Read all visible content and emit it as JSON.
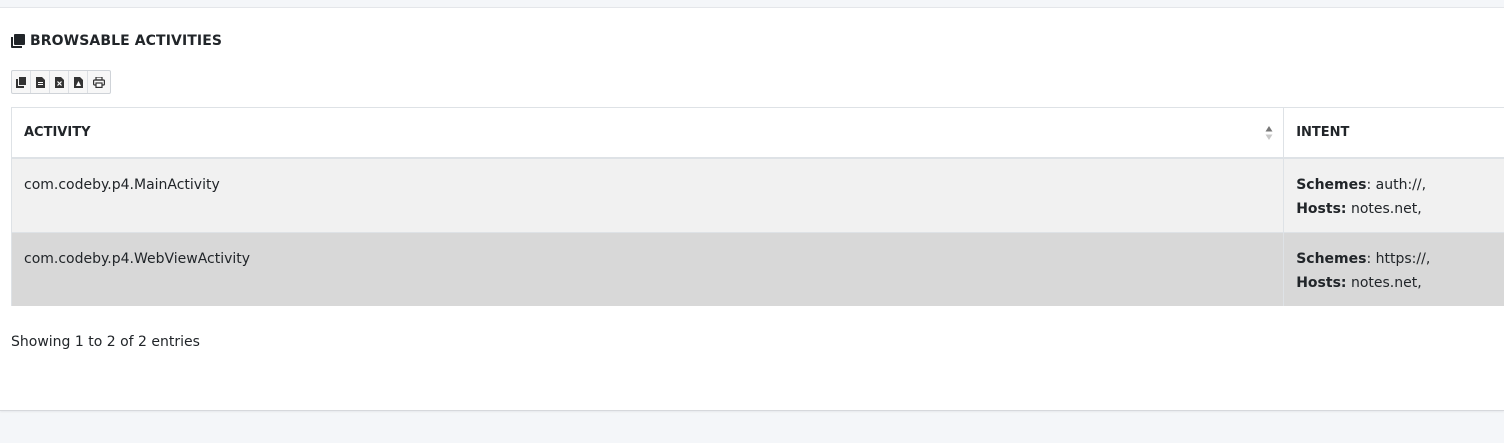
{
  "section": {
    "title": "BROWSABLE ACTIVITIES",
    "icon": "copy-icon"
  },
  "toolbar": {
    "buttons": [
      {
        "name": "copy-button",
        "icon": "copy-icon"
      },
      {
        "name": "csv-button",
        "icon": "file-csv-icon"
      },
      {
        "name": "excel-button",
        "icon": "file-excel-icon"
      },
      {
        "name": "pdf-button",
        "icon": "file-pdf-icon"
      },
      {
        "name": "print-button",
        "icon": "print-icon"
      }
    ]
  },
  "table": {
    "columns": [
      "ACTIVITY",
      "INTENT"
    ],
    "rows": [
      {
        "activity": "com.codeby.p4.MainActivity",
        "schemes_label": "Schemes",
        "schemes_value": ": auth://,",
        "hosts_label": "Hosts:",
        "hosts_value": " notes.net,"
      },
      {
        "activity": "com.codeby.p4.WebViewActivity",
        "schemes_label": "Schemes",
        "schemes_value": ": https://,",
        "hosts_label": "Hosts:",
        "hosts_value": " notes.net,"
      }
    ]
  },
  "footer": {
    "info": "Showing 1 to 2 of 2 entries"
  },
  "colors": {
    "row_odd": "#f1f1f1",
    "row_even": "#d8d8d8",
    "text": "#212529"
  }
}
